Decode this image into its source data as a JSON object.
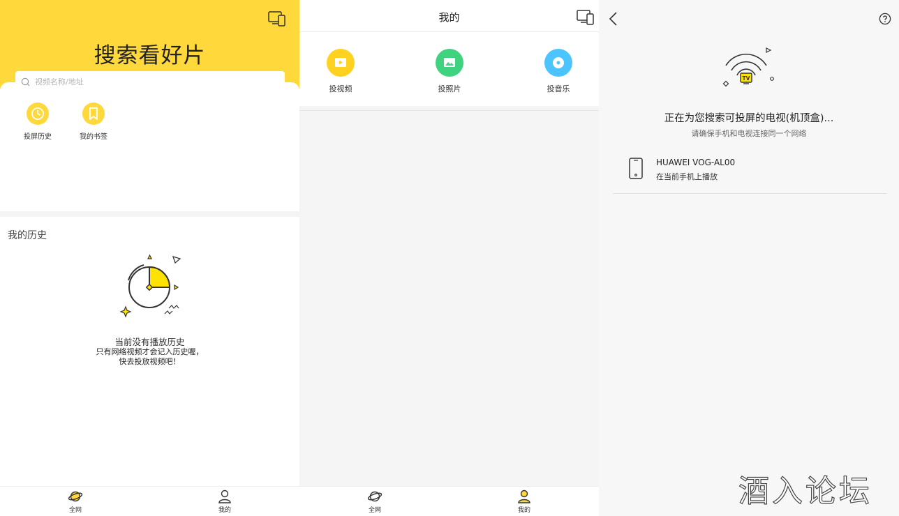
{
  "panel_home": {
    "title": "搜索看好片",
    "search": {
      "placeholder": "视频名称/地址",
      "value": ""
    },
    "quick_actions": [
      {
        "label": "投屏历史",
        "icon": "clock-icon"
      },
      {
        "label": "我的书签",
        "icon": "bookmark-icon"
      }
    ],
    "history_heading": "我的历史",
    "empty_state": {
      "title": "当前没有播放历史",
      "desc_line1": "只有网络视频才会记入历史喔，",
      "desc_line2": "快去投放视频吧！"
    },
    "nav": [
      {
        "label": "全网",
        "icon": "planet-icon",
        "active": true
      },
      {
        "label": "我的",
        "icon": "user-icon",
        "active": false
      }
    ]
  },
  "panel_mine": {
    "title": "我的",
    "actions": [
      {
        "label": "投视频",
        "icon": "video-play-icon",
        "color": "#ffd21f"
      },
      {
        "label": "投照片",
        "icon": "photo-icon",
        "color": "#3fd27f"
      },
      {
        "label": "投音乐",
        "icon": "music-disc-icon",
        "color": "#4cc4ff"
      }
    ],
    "nav": [
      {
        "label": "全网",
        "icon": "planet-icon",
        "active": false
      },
      {
        "label": "我的",
        "icon": "user-icon",
        "active": true
      }
    ]
  },
  "panel_search": {
    "title": "正在为您搜索可投屏的电视(机顶盒)...",
    "subtitle": "请确保手机和电视连接同一个网络",
    "tv_badge": "TV",
    "device": {
      "name": "HUAWEI  VOG-AL00",
      "sub": "在当前手机上播放",
      "icon": "phone-icon"
    },
    "watermark": "酒入论坛"
  },
  "colors": {
    "accent": "#ffd93b",
    "outline": "#333333"
  }
}
